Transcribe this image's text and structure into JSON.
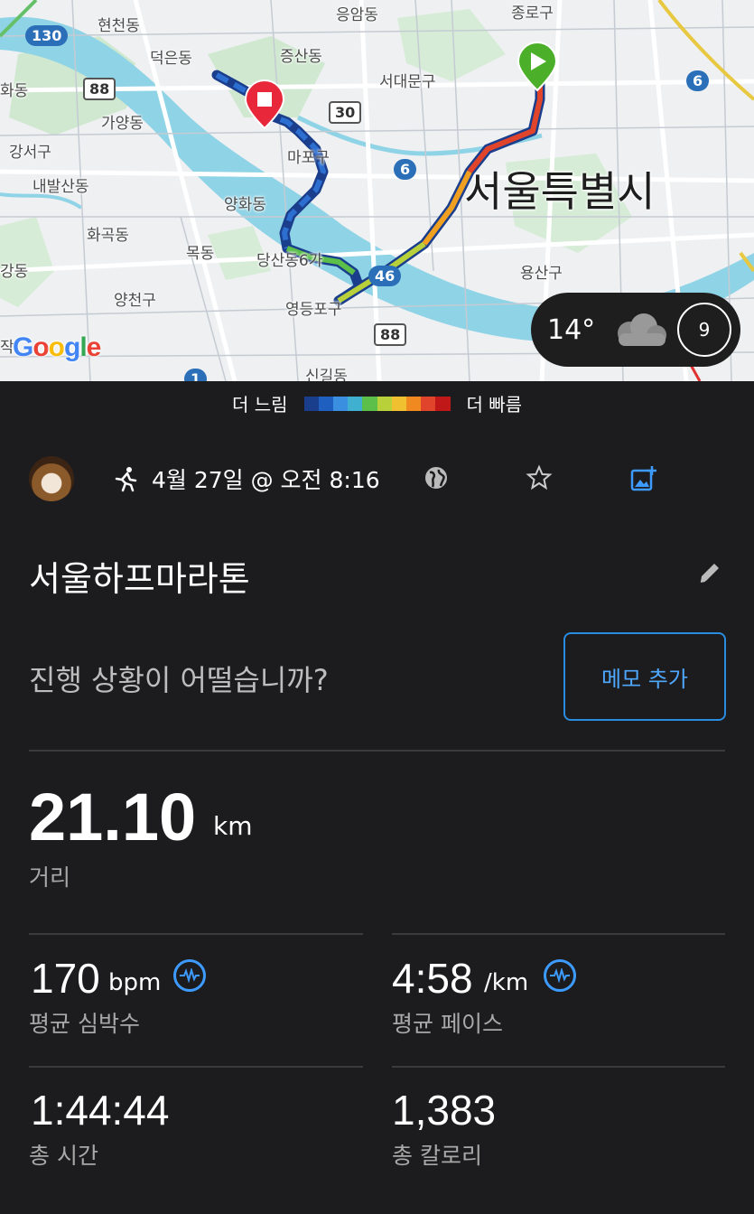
{
  "map": {
    "labels": {
      "hyeoncheon": "현천동",
      "eungam": "응암동",
      "jongno": "종로구",
      "deogeun": "덕은동",
      "jeungsan": "증산동",
      "seodaemun": "서대문구",
      "hwa": "화동",
      "gayang": "가양동",
      "gangseo": "강서구",
      "mapo": "마포구",
      "naebalsan": "내발산동",
      "yanghwa": "양화동",
      "seoul": "서울특별시",
      "hwagok": "화곡동",
      "mokdong": "목동",
      "dangsan": "당산동6가",
      "gang": "강동",
      "yongsan": "용산구",
      "yangcheon": "양천구",
      "yeongdeungpo": "영등포구",
      "jak": "작",
      "singil": "신길동"
    },
    "shields": {
      "s130": "130",
      "s88a": "88",
      "s30": "30",
      "s6a": "6",
      "s6b": "6",
      "s46": "46",
      "s88b": "88",
      "s1": "1"
    },
    "google": "Google",
    "weather": {
      "temp": "14°",
      "uv": "9"
    }
  },
  "legend": {
    "slower": "더 느림",
    "faster": "더 빠름",
    "colors": [
      "#1a3e8c",
      "#1f5fbf",
      "#3a8fe0",
      "#3fb0d0",
      "#5cbf4a",
      "#b8d13a",
      "#f0c030",
      "#f08a20",
      "#e0442a",
      "#c01818"
    ]
  },
  "activity": {
    "datetime": "4월 27일 @ 오전 8:16",
    "title": "서울하프마라톤",
    "prompt": "진행 상황이 어떨습니까?",
    "memo_button": "메모 추가"
  },
  "stats": {
    "distance": {
      "value": "21.10",
      "unit": "km",
      "label": "거리"
    },
    "heart_rate": {
      "value": "170",
      "unit": "bpm",
      "label": "평균 심박수"
    },
    "pace": {
      "value": "4:58",
      "unit": "/km",
      "label": "평균 페이스"
    },
    "time": {
      "value": "1:44:44",
      "label": "총 시간"
    },
    "calories": {
      "value": "1,383",
      "label": "총 칼로리"
    }
  },
  "colors": {
    "accent": "#3d9bff",
    "background": "#1c1c1e"
  }
}
